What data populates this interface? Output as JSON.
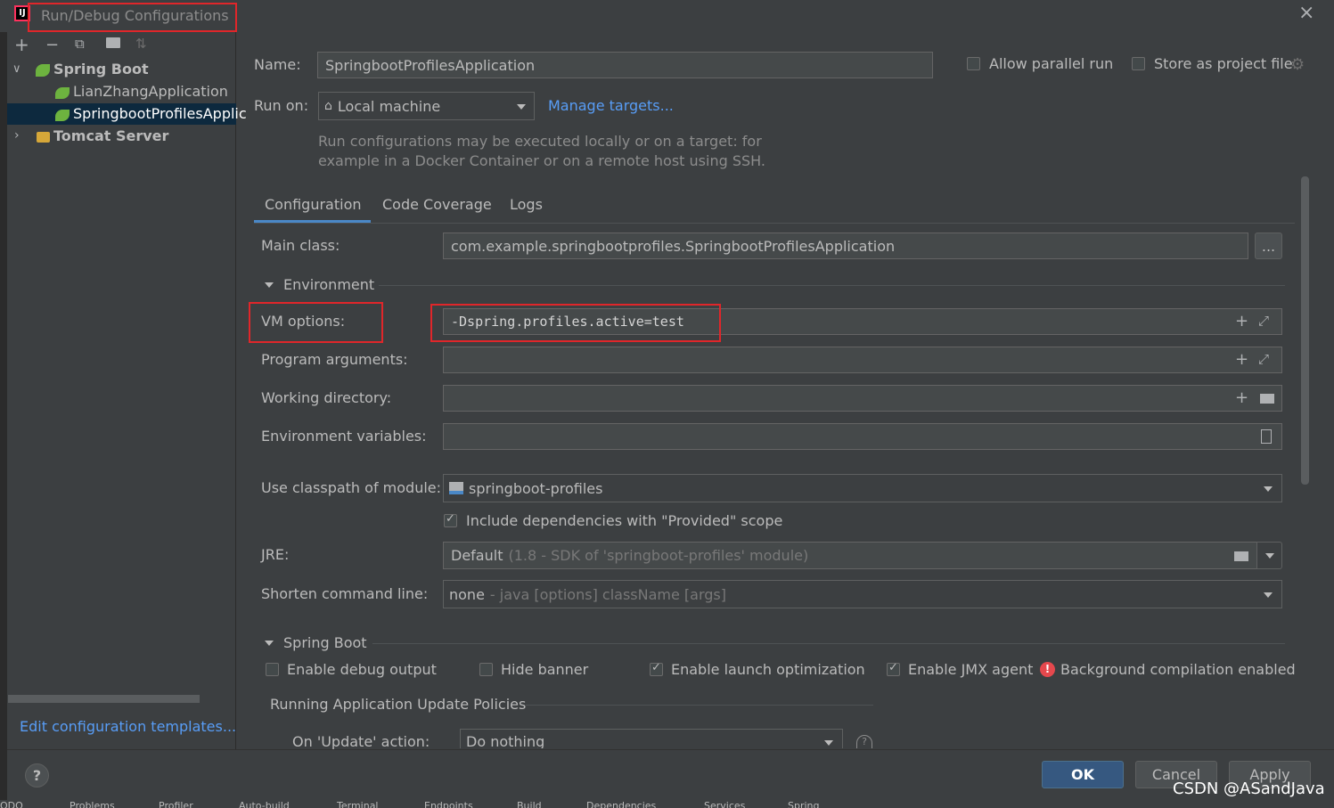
{
  "window": {
    "title": "Run/Debug Configurations",
    "close": "×"
  },
  "toolbar": {
    "add": "+",
    "remove": "−",
    "copy": "⧉",
    "folder": "📁",
    "sort": "⇅"
  },
  "tree": {
    "spring_boot": "Spring Boot",
    "items": [
      "LianZhangApplication",
      "SpringbootProfilesApplic"
    ],
    "tomcat": "Tomcat Server"
  },
  "edit_templates": "Edit configuration templates...",
  "help": "?",
  "name": {
    "label": "Name:",
    "value": "SpringbootProfilesApplication"
  },
  "allow_parallel": "Allow parallel run",
  "store_project": "Store as project file",
  "run_on": {
    "label": "Run on:",
    "value": "Local machine",
    "manage": "Manage targets..."
  },
  "run_desc": [
    "Run configurations may be executed locally or on a target: for",
    "example in a Docker Container or on a remote host using SSH."
  ],
  "tabs": [
    "Configuration",
    "Code Coverage",
    "Logs"
  ],
  "main_class": {
    "label": "Main class:",
    "value": "com.example.springbootprofiles.SpringbootProfilesApplication",
    "browse": "..."
  },
  "environment": "Environment",
  "vm_options": {
    "label": "VM options:",
    "value": "-Dspring.profiles.active=test"
  },
  "program_args": {
    "label": "Program arguments:",
    "value": ""
  },
  "working_dir": {
    "label": "Working directory:",
    "value": ""
  },
  "env_vars": {
    "label": "Environment variables:",
    "value": ""
  },
  "classpath": {
    "label": "Use classpath of module:",
    "value": "springboot-profiles"
  },
  "include_deps": "Include dependencies with \"Provided\" scope",
  "jre": {
    "label": "JRE:",
    "value": "Default",
    "hint": "(1.8 - SDK of 'springboot-profiles' module)"
  },
  "shorten": {
    "label": "Shorten command line:",
    "value": "none",
    "hint": "- java [options] className [args]"
  },
  "spring_boot_section": "Spring Boot",
  "opts": {
    "debug": "Enable debug output",
    "banner": "Hide banner",
    "launch": "Enable launch optimization",
    "jmx": "Enable JMX agent",
    "bg": "Background compilation enabled"
  },
  "update_policies": "Running Application Update Policies",
  "on_update": {
    "label": "On 'Update' action:",
    "value": "Do nothing"
  },
  "buttons": {
    "ok": "OK",
    "cancel": "Cancel",
    "apply": "Apply"
  },
  "watermark": "CSDN @ASandJava",
  "status_bar": [
    "ODO",
    "Problems",
    "Profiler",
    "Auto-build",
    "Terminal",
    "Endpoints",
    "Build",
    "Dependencies",
    "Services",
    "Spring"
  ],
  "colors": {
    "accent": "#589df6",
    "ok": "#365880",
    "highlight": "#e0262a",
    "selection": "#0d293e"
  }
}
